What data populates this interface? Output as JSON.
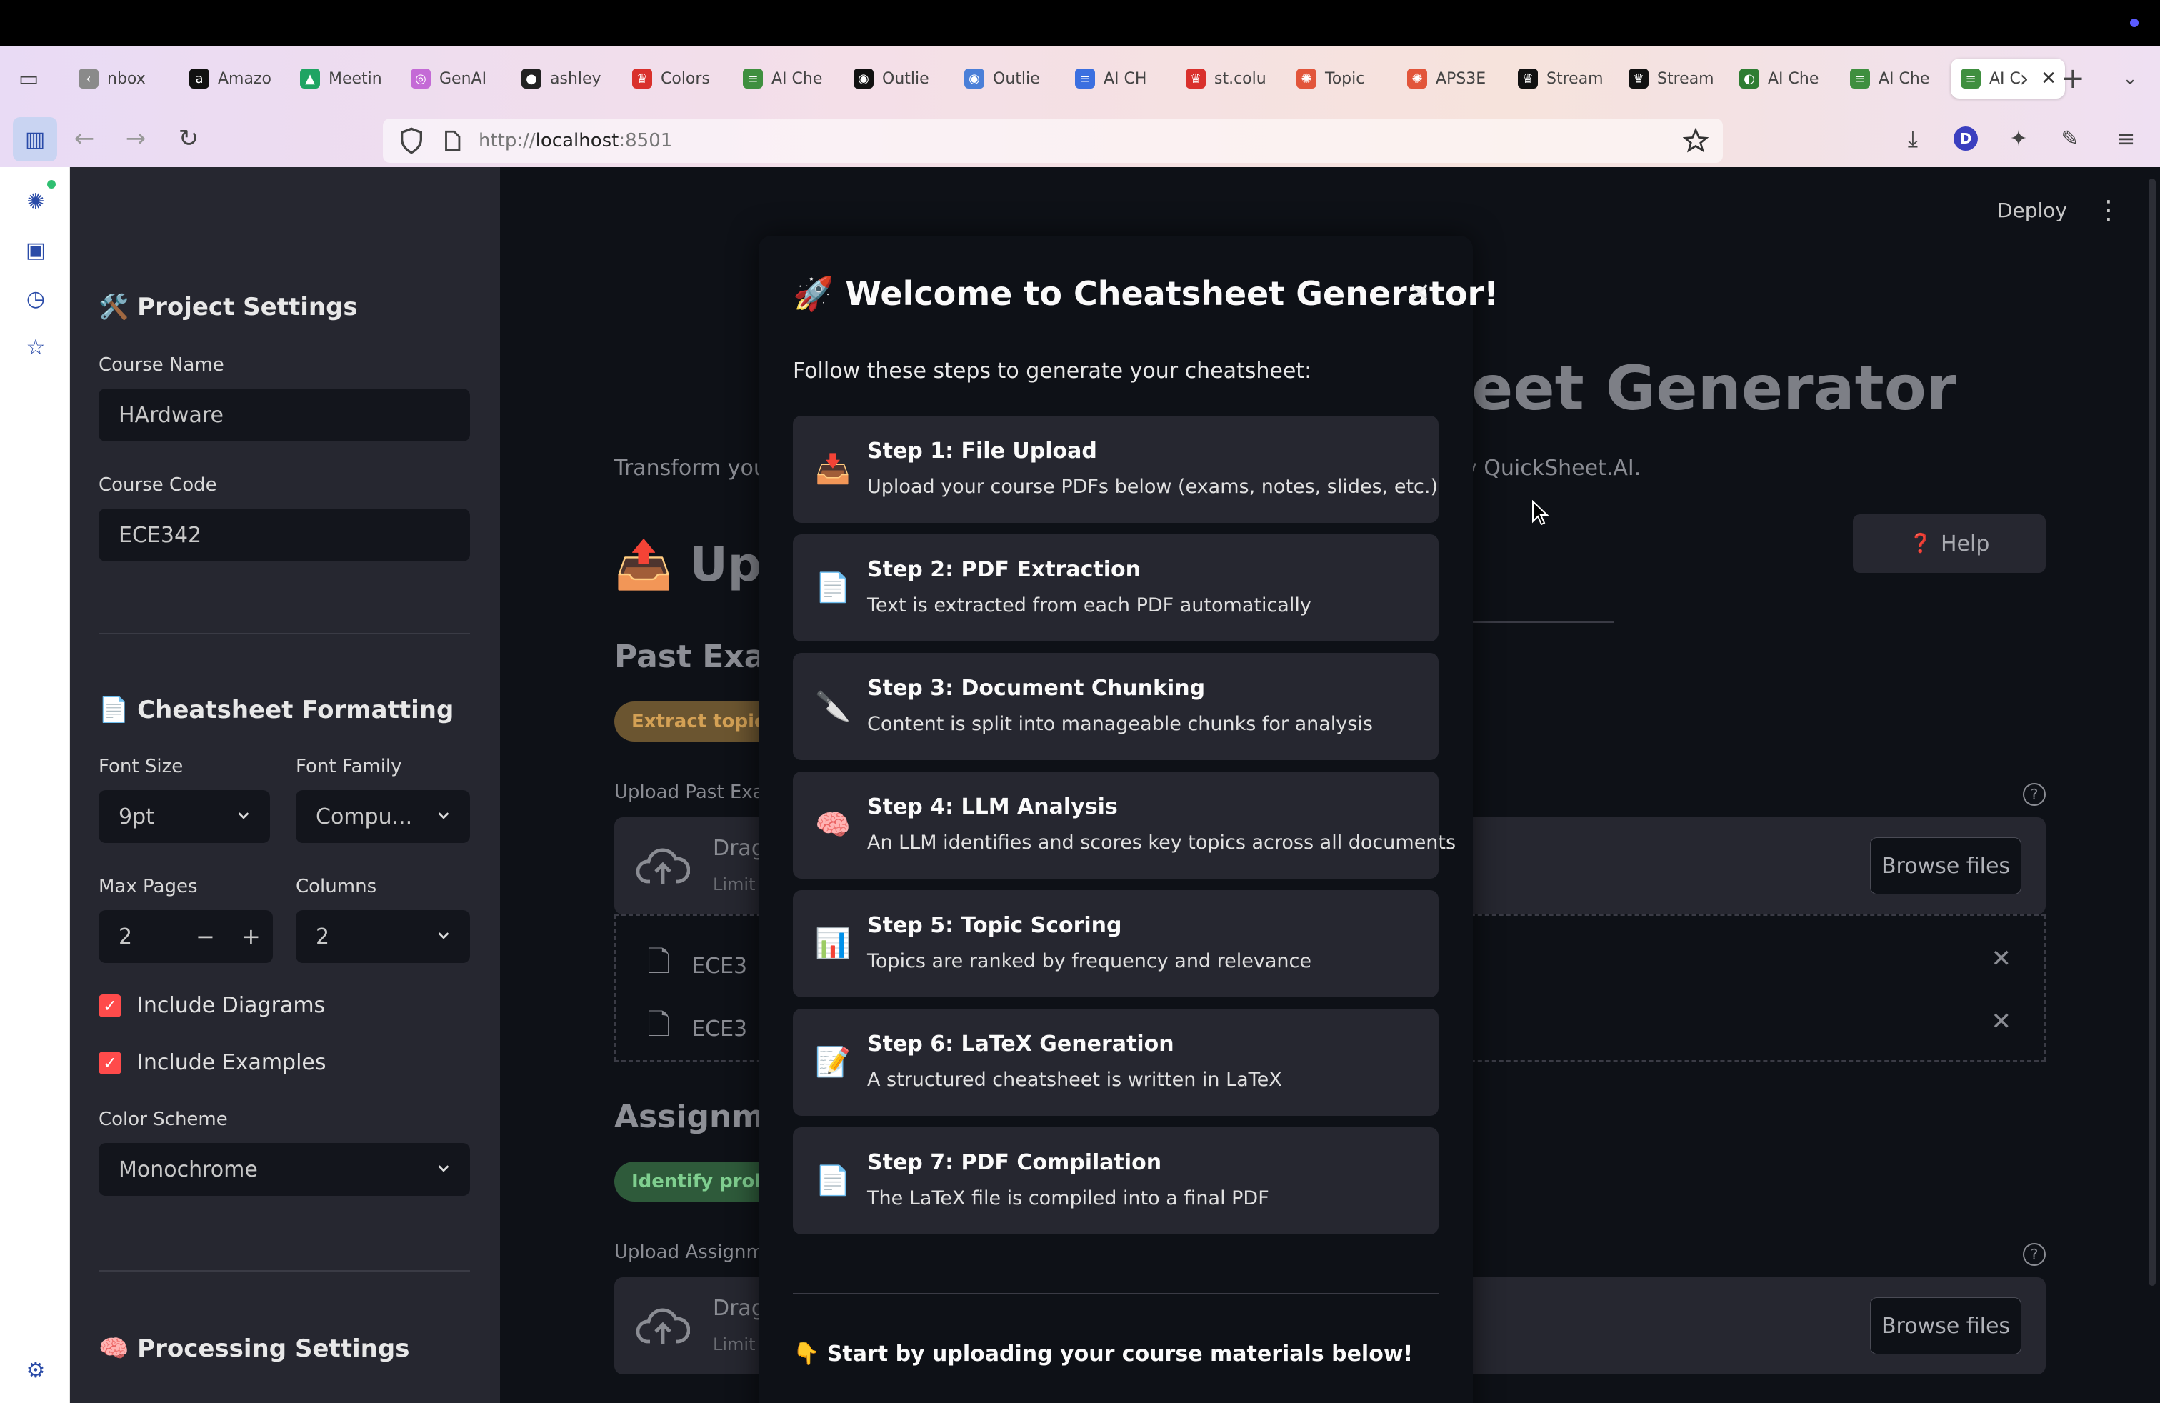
{
  "browser": {
    "tabs": [
      {
        "label": "nbox",
        "fav_bg": "#8a8a8a",
        "fav_glyph": "‹"
      },
      {
        "label": "Amazo",
        "fav_bg": "#111111",
        "fav_glyph": "a"
      },
      {
        "label": "Meetin",
        "fav_bg": "#1fa463",
        "fav_glyph": "▲"
      },
      {
        "label": "GenAI",
        "fav_bg": "#c46ad6",
        "fav_glyph": "◎"
      },
      {
        "label": "ashley",
        "fav_bg": "#222222",
        "fav_glyph": "●"
      },
      {
        "label": "Colors",
        "fav_bg": "#d9302c",
        "fav_glyph": "♛"
      },
      {
        "label": "AI Che",
        "fav_bg": "#3f8f3f",
        "fav_glyph": "≡"
      },
      {
        "label": "Outlie",
        "fav_bg": "#111111",
        "fav_glyph": "◉"
      },
      {
        "label": "Outlie",
        "fav_bg": "#4a7fd8",
        "fav_glyph": "◉"
      },
      {
        "label": "AI CH",
        "fav_bg": "#3b6fe0",
        "fav_glyph": "≡"
      },
      {
        "label": "st.colu",
        "fav_bg": "#d9302c",
        "fav_glyph": "♛"
      },
      {
        "label": "Topic",
        "fav_bg": "#e2553a",
        "fav_glyph": "✺"
      },
      {
        "label": "APS3E",
        "fav_bg": "#e2553a",
        "fav_glyph": "✺"
      },
      {
        "label": "Stream",
        "fav_bg": "#111111",
        "fav_glyph": "♛"
      },
      {
        "label": "Stream",
        "fav_bg": "#111111",
        "fav_glyph": "♛"
      },
      {
        "label": "AI Che",
        "fav_bg": "#2e7d32",
        "fav_glyph": "◐"
      },
      {
        "label": "AI Che",
        "fav_bg": "#3f8f3f",
        "fav_glyph": "≡"
      },
      {
        "label": "AI C",
        "fav_bg": "#3f8f3f",
        "fav_glyph": "≡"
      }
    ],
    "url_prefix": "http://",
    "url_host": "localhost",
    "url_port": ":8501",
    "profile_initial": "D"
  },
  "sidebar": {
    "project_settings_title": "🛠️ Project Settings",
    "course_name_label": "Course Name",
    "course_name_value": "HArdware",
    "course_code_label": "Course Code",
    "course_code_value": "ECE342",
    "formatting_title": "📄 Cheatsheet Formatting",
    "font_size_label": "Font Size",
    "font_size_value": "9pt",
    "font_family_label": "Font Family",
    "font_family_value": "Compu...",
    "max_pages_label": "Max Pages",
    "max_pages_value": "2",
    "stepper_minus": "−",
    "stepper_plus": "+",
    "columns_label": "Columns",
    "columns_value": "2",
    "include_diagrams": "Include Diagrams",
    "include_examples": "Include Examples",
    "check_mark": "✓",
    "color_scheme_label": "Color Scheme",
    "color_scheme_value": "Monochrome",
    "processing_title": "🧠 Processing Settings"
  },
  "main": {
    "deploy": "Deploy",
    "kebab": "⋮",
    "title_fragment": "eet Generator",
    "subtitle_left": "Transform your",
    "subtitle_right": "y QuickSheet.AI.",
    "help_label": "Help",
    "help_icon": "❓",
    "upload_heading": "📤 Uplo",
    "past_exams_heading": "Past Exam",
    "past_exams_pill": "Extract topics &",
    "upload_past_label": "Upload Past Exam",
    "drag_text": "Drag",
    "limit_text": "Limit",
    "browse_label": "Browse files",
    "file_1": "ECE3",
    "file_2": "ECE3",
    "assignments_heading": "Assignmer",
    "assignments_pill": "Identify probler",
    "upload_assign_label": "Upload Assignme"
  },
  "modal": {
    "title": "🚀 Welcome to Cheatsheet Generator!",
    "close": "×",
    "intro": "Follow these steps to generate your cheatsheet:",
    "steps": [
      {
        "icon": "📥",
        "title": "Step 1: File Upload",
        "desc": "Upload your course PDFs below (exams, notes, slides, etc.)"
      },
      {
        "icon": "📄",
        "title": "Step 2: PDF Extraction",
        "desc": "Text is extracted from each PDF automatically"
      },
      {
        "icon": "🔪",
        "title": "Step 3: Document Chunking",
        "desc": "Content is split into manageable chunks for analysis"
      },
      {
        "icon": "🧠",
        "title": "Step 4: LLM Analysis",
        "desc": "An LLM identifies and scores key topics across all documents"
      },
      {
        "icon": "📊",
        "title": "Step 5: Topic Scoring",
        "desc": "Topics are ranked by frequency and relevance"
      },
      {
        "icon": "📝",
        "title": "Step 6: LaTeX Generation",
        "desc": "A structured cheatsheet is written in LaTeX"
      },
      {
        "icon": "📄",
        "title": "Step 7: PDF Compilation",
        "desc": "The LaTeX file is compiled into a final PDF"
      }
    ],
    "footer": "👇 Start by uploading your course materials below!"
  },
  "colors": {
    "accent_red": "#ff4b4b",
    "surface": "#262730",
    "background": "#0e1117",
    "pill_orange": "#d4a155",
    "pill_green": "#7fcf8f"
  }
}
